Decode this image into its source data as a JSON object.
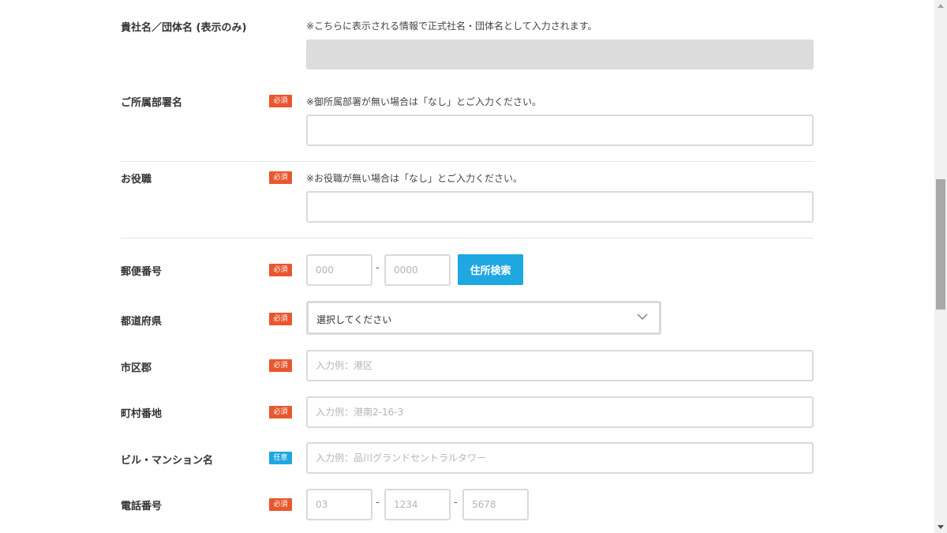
{
  "company": {
    "label": "貴社名／団体名 (表示のみ)",
    "note": "※こちらに表示される情報で正式社名・団体名として入力されます。",
    "value": ""
  },
  "department": {
    "label": "ご所属部署名",
    "badge": "必須",
    "note": "※御所属部署が無い場合は「なし」とご入力ください。",
    "value": ""
  },
  "position": {
    "label": "お役職",
    "badge": "必須",
    "note": "※お役職が無い場合は「なし」とご入力ください。",
    "value": ""
  },
  "postal": {
    "label": "郵便番号",
    "badge": "必須",
    "placeholder1": "000",
    "placeholder2": "0000",
    "separator": "-",
    "search_button": "住所検索"
  },
  "prefecture": {
    "label": "都道府県",
    "badge": "必須",
    "selected": "選択してください",
    "icon": "chevron-down-icon"
  },
  "city": {
    "label": "市区郡",
    "badge": "必須",
    "placeholder": "入力例：港区"
  },
  "street": {
    "label": "町村番地",
    "badge": "必須",
    "placeholder": "入力例：港南2-16-3"
  },
  "building": {
    "label": "ビル・マンション名",
    "badge": "任意",
    "placeholder": "入力例：品川グランドセントラルタワー"
  },
  "phone": {
    "label": "電話番号",
    "badge": "必須",
    "placeholder1": "03",
    "placeholder2": "1234",
    "placeholder3": "5678",
    "separator": "-"
  },
  "colors": {
    "required_badge": "#e8572e",
    "optional_badge": "#1ea7e1",
    "button": "#1ea7e1"
  }
}
